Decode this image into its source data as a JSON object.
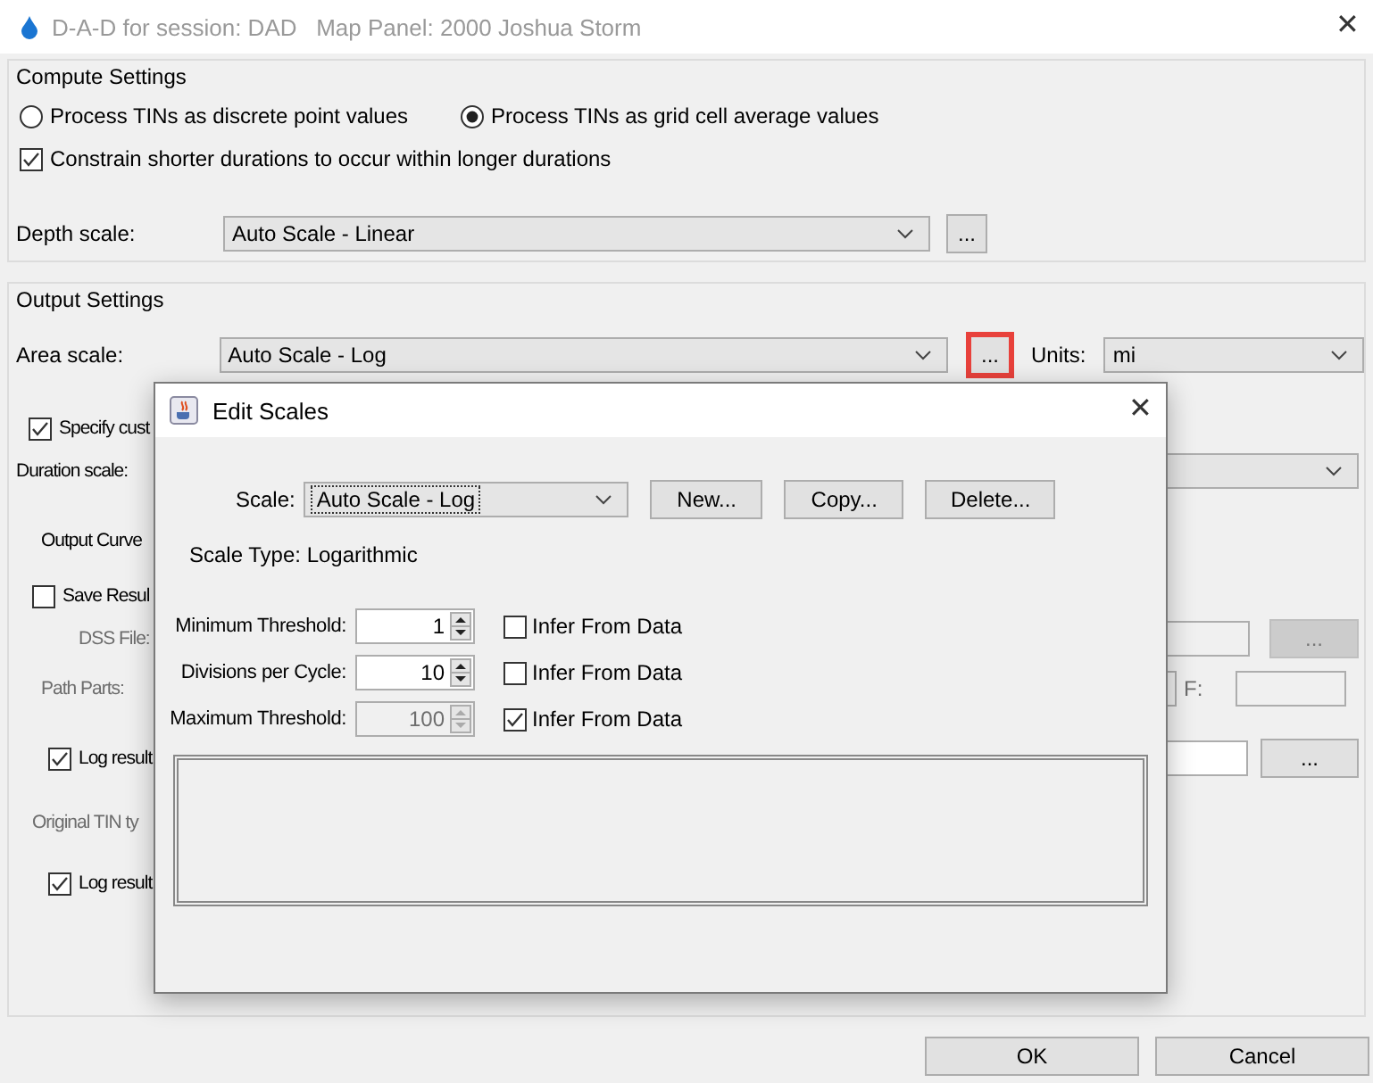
{
  "window": {
    "title": "D-A-D for session: DAD   Map Panel: 2000 Joshua Storm",
    "close": "✕"
  },
  "compute_settings": {
    "title": "Compute Settings",
    "process_options": [
      {
        "label": "Process TINs as discrete point values",
        "selected": false
      },
      {
        "label": "Process TINs as grid cell average values",
        "selected": true
      }
    ],
    "constrain": {
      "label": "Constrain shorter durations to occur within longer durations",
      "checked": true
    },
    "depth_scale": {
      "label": "Depth scale:",
      "value": "Auto Scale - Linear",
      "button": "..."
    }
  },
  "output_settings": {
    "title": "Output Settings",
    "area_scale": {
      "label": "Area scale:",
      "value": "Auto Scale - Log",
      "button": "...",
      "highlighted": true
    },
    "units": {
      "label": "Units:",
      "value": "mi"
    },
    "specify": {
      "label": "Specify cust",
      "checked": true
    },
    "duration_scale": {
      "label": "Duration scale:"
    },
    "output_curve": {
      "title": "Output Curve"
    },
    "save_results": {
      "label": "Save Resul",
      "checked": false
    },
    "dss_file": {
      "label": "DSS File:",
      "disabled": true,
      "button": "..."
    },
    "path_parts": {
      "label": "Path Parts:",
      "disabled": true,
      "f_label": "F:"
    },
    "log_results_1": {
      "label": "Log result",
      "checked": true,
      "button": "..."
    },
    "original_tin": {
      "label": "Original TIN ty",
      "disabled": true
    },
    "log_results_2": {
      "label": "Log result",
      "checked": true
    }
  },
  "buttons": [
    {
      "label": "OK"
    },
    {
      "label": "Cancel"
    }
  ],
  "dialog": {
    "title": "Edit Scales",
    "close": "✕",
    "scale_label": "Scale:",
    "scale_value": "Auto Scale - Log",
    "actions": [
      {
        "label": "New..."
      },
      {
        "label": "Copy..."
      },
      {
        "label": "Delete..."
      }
    ],
    "scale_type": "Scale Type: Logarithmic",
    "thresholds": [
      {
        "label": "Minimum Threshold:",
        "value": "1",
        "disabled": false,
        "infer_label": "Infer From Data",
        "infer_checked": false
      },
      {
        "label": "Divisions per Cycle:",
        "value": "10",
        "disabled": false,
        "infer_label": "Infer From Data",
        "infer_checked": false
      },
      {
        "label": "Maximum Threshold:",
        "value": "100",
        "disabled": true,
        "infer_label": "Infer From Data",
        "infer_checked": true
      }
    ]
  }
}
